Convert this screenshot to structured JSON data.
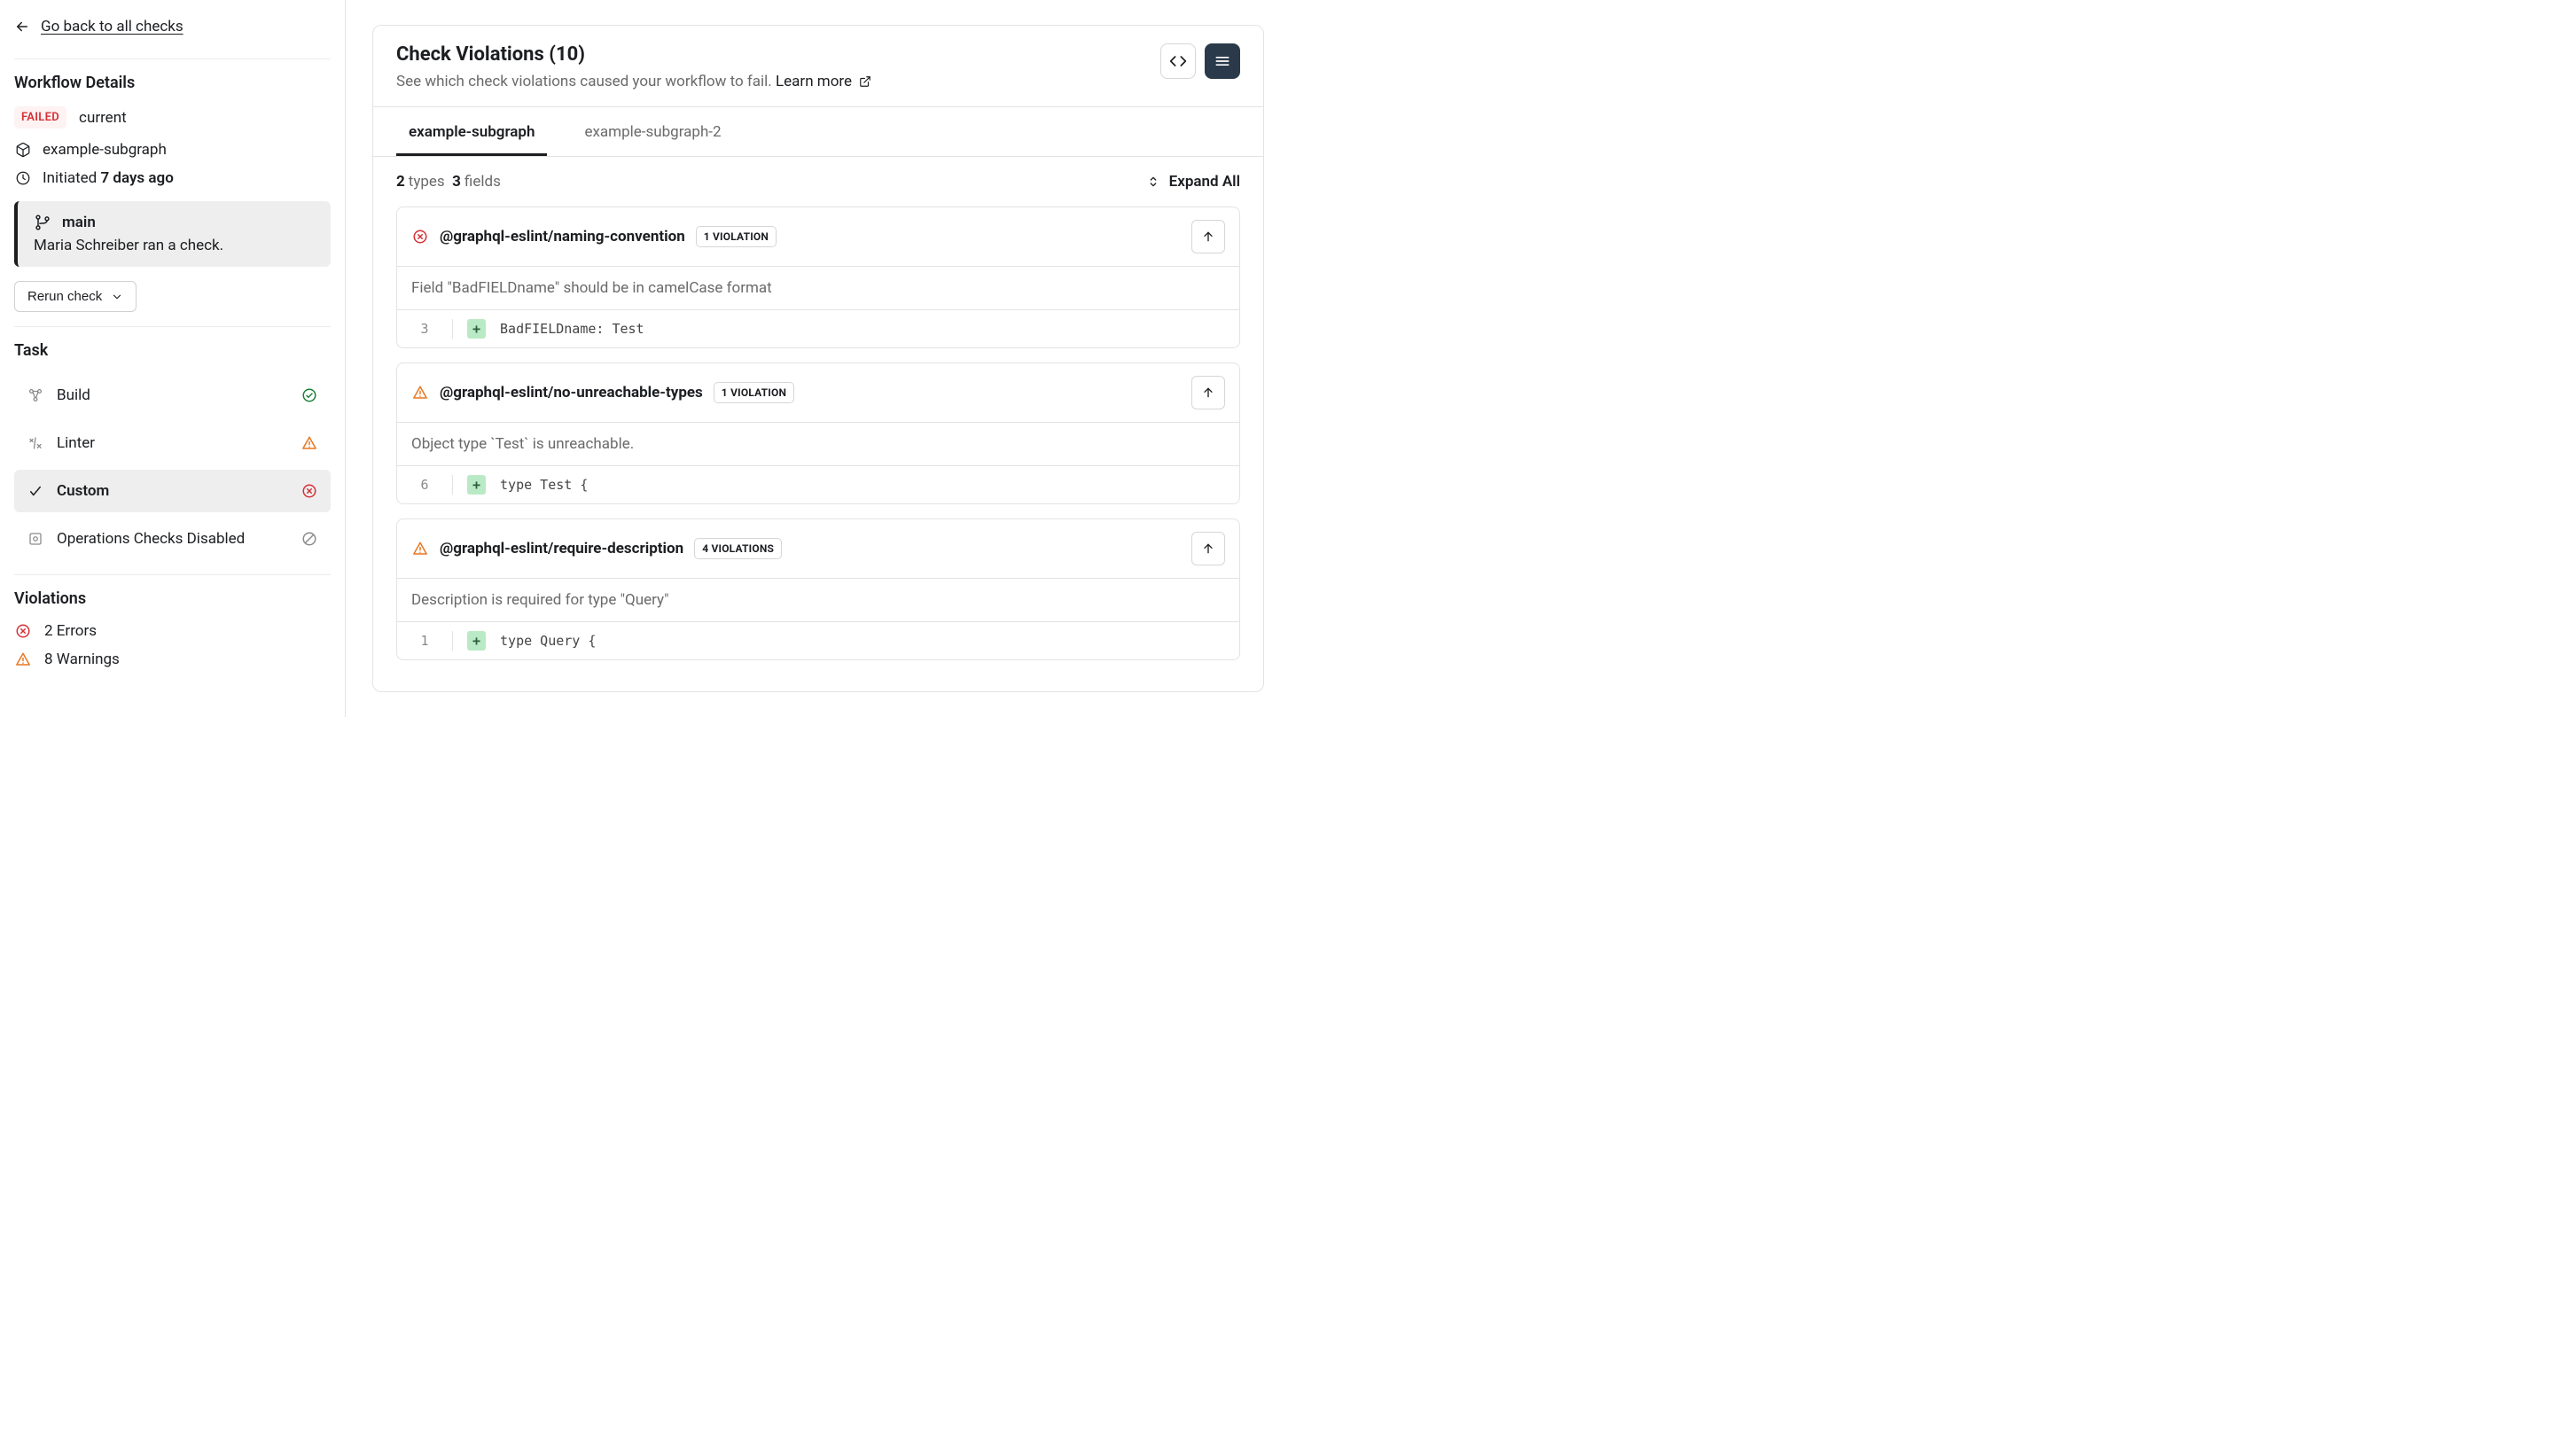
{
  "sidebar": {
    "back_link": "Go back to all checks",
    "workflow_details_title": "Workflow Details",
    "status_badge": "FAILED",
    "status_label": "current",
    "subgraph_label": "example-subgraph",
    "initiated_prefix": "Initiated ",
    "initiated_time": "7 days ago",
    "branch": {
      "name": "main",
      "activity": "Maria Schreiber ran a check."
    },
    "rerun_label": "Rerun check",
    "task_title": "Task",
    "tasks": [
      {
        "label": "Build",
        "status": "ok"
      },
      {
        "label": "Linter",
        "status": "warn"
      },
      {
        "label": "Custom",
        "status": "err",
        "active": true
      },
      {
        "label": "Operations Checks Disabled",
        "status": "disabled"
      }
    ],
    "violations_title": "Violations",
    "errors_label": "2 Errors",
    "warnings_label": "8 Warnings"
  },
  "main": {
    "title": "Check Violations (10)",
    "subtitle_prefix": "See which check violations caused your workflow to fail. ",
    "learn_more": "Learn more",
    "tabs": [
      {
        "label": "example-subgraph",
        "active": true
      },
      {
        "label": "example-subgraph-2"
      }
    ],
    "counts": {
      "types_n": "2",
      "types_label": "types",
      "fields_n": "3",
      "fields_label": "fields"
    },
    "expand_all_label": "Expand All",
    "violations": [
      {
        "severity": "err",
        "rule": "@graphql-eslint/naming-convention",
        "pill": "1 VIOLATION",
        "message": "Field \"BadFIELDname\" should be in camelCase format",
        "line": "3",
        "code": "BadFIELDname: Test"
      },
      {
        "severity": "warn",
        "rule": "@graphql-eslint/no-unreachable-types",
        "pill": "1 VIOLATION",
        "message": "Object type `Test` is unreachable.",
        "line": "6",
        "code": "type Test {"
      },
      {
        "severity": "warn",
        "rule": "@graphql-eslint/require-description",
        "pill": "4 VIOLATIONS",
        "message": "Description is required for type \"Query\"",
        "line": "1",
        "code": "type Query {"
      }
    ]
  }
}
